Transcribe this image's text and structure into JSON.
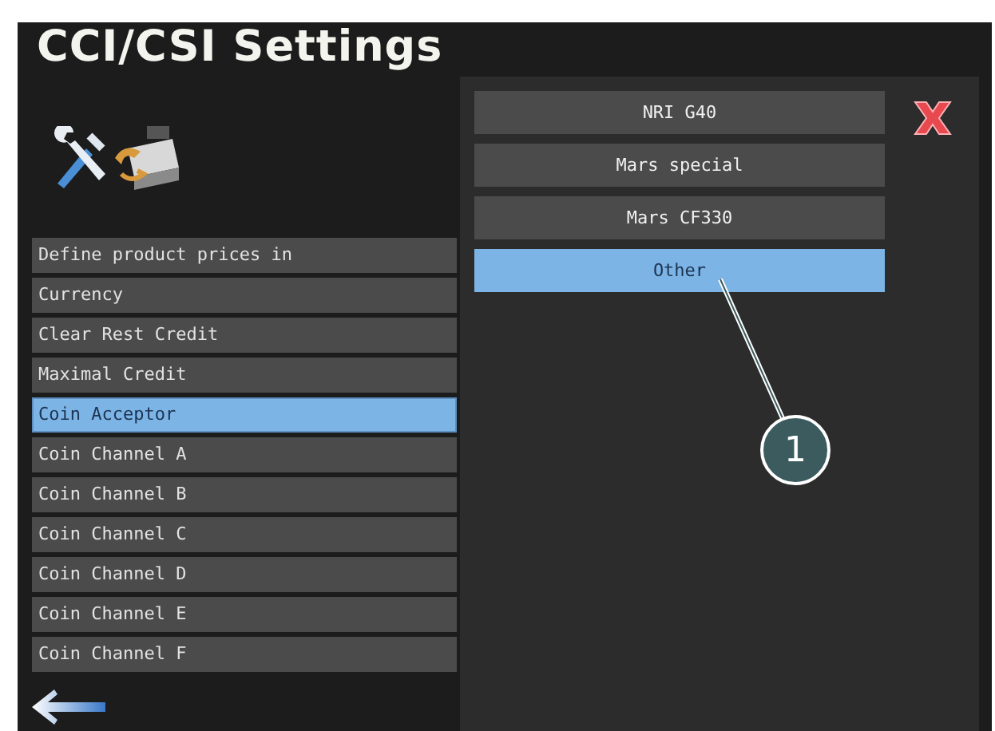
{
  "title": "CCI/CSI Settings",
  "menu": [
    {
      "label": "Define product prices in",
      "selected": false
    },
    {
      "label": "Currency",
      "selected": false
    },
    {
      "label": "Clear Rest Credit",
      "selected": false
    },
    {
      "label": "Maximal Credit",
      "selected": false
    },
    {
      "label": "Coin Acceptor",
      "selected": true
    },
    {
      "label": "Coin Channel A",
      "selected": false
    },
    {
      "label": "Coin Channel B",
      "selected": false
    },
    {
      "label": "Coin Channel C",
      "selected": false
    },
    {
      "label": "Coin Channel D",
      "selected": false
    },
    {
      "label": "Coin Channel E",
      "selected": false
    },
    {
      "label": "Coin Channel F",
      "selected": false
    }
  ],
  "options": [
    {
      "label": "NRI G40",
      "selected": false
    },
    {
      "label": "Mars special",
      "selected": false
    },
    {
      "label": "Mars CF330",
      "selected": false
    },
    {
      "label": "Other",
      "selected": true
    }
  ],
  "callout": {
    "number": "1"
  }
}
